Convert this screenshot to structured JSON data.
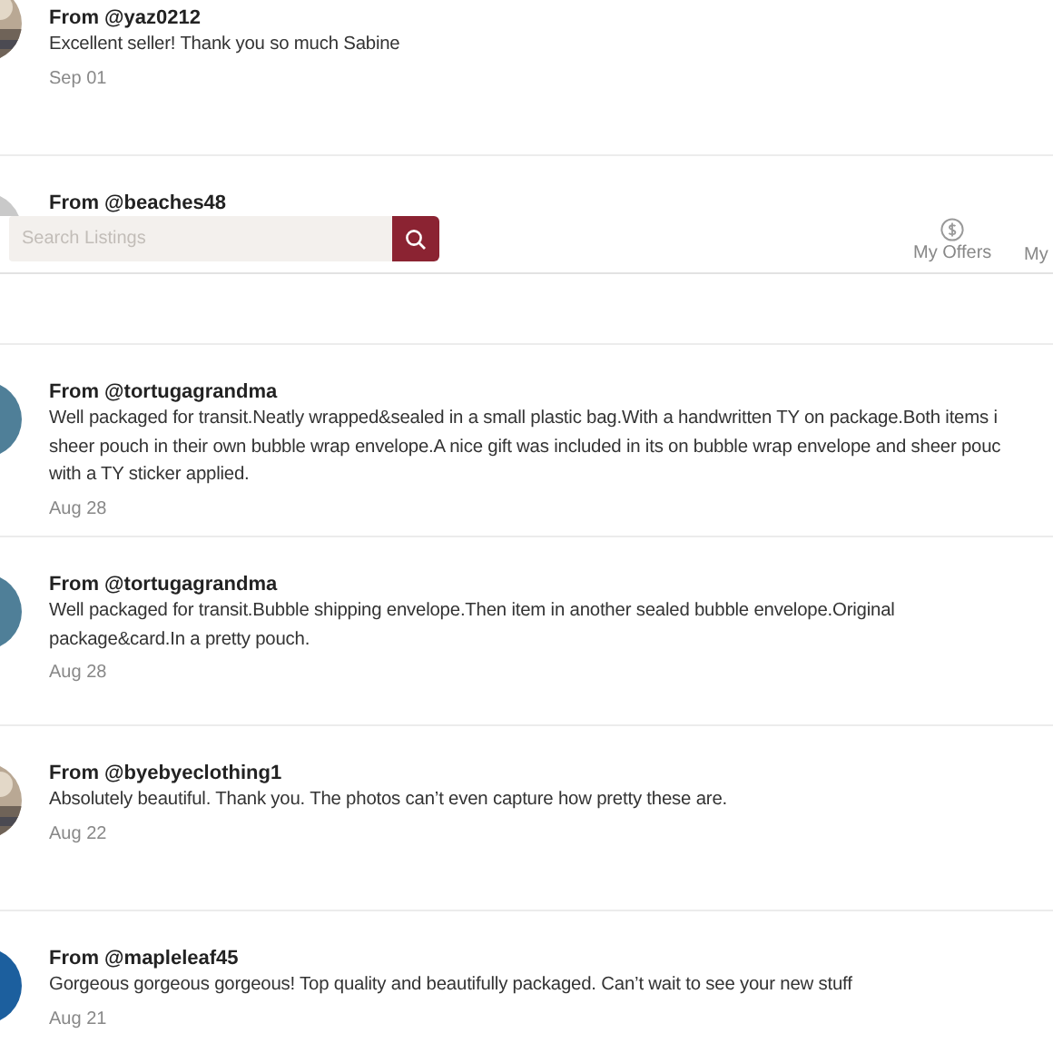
{
  "reviews": [
    {
      "from": "From @yaz0212",
      "lines": [
        "Excellent seller! Thank you so much Sabine"
      ],
      "date": "Sep 01",
      "avatar": {
        "kind": "picture"
      }
    },
    {
      "from": "From @beaches48",
      "avatar": {
        "kind": "plain",
        "color": "#c9c9c9"
      }
    },
    {
      "from": "From @tortugagrandma",
      "lines": [
        "Well packaged for transit.Neatly wrapped&sealed in a small plastic bag.With a handwritten TY on package.Both items i",
        "sheer pouch in their own bubble wrap envelope.A nice gift was included in its on bubble wrap envelope and sheer pouc",
        "with a TY sticker applied."
      ],
      "date": "Aug 28",
      "avatar": {
        "kind": "plain",
        "color": "#4f7f98"
      }
    },
    {
      "from": "From @tortugagrandma",
      "lines": [
        "Well packaged for transit.Bubble shipping envelope.Then item in another sealed bubble envelope.Original",
        "package&card.In a pretty pouch."
      ],
      "date": "Aug 28",
      "avatar": {
        "kind": "plain",
        "color": "#4f7f98"
      }
    },
    {
      "from": "From @byebyeclothing1",
      "lines": [
        "Absolutely beautiful. Thank you. The photos can’t even capture how pretty these are."
      ],
      "date": "Aug 22",
      "avatar": {
        "kind": "picture"
      }
    },
    {
      "from": "From @mapleleaf45",
      "lines": [
        "Gorgeous gorgeous gorgeous! Top quality and beautifully packaged. Can’t wait to see your new stuff"
      ],
      "date": "Aug 21",
      "avatar": {
        "kind": "plain",
        "color": "#1c5f9e"
      }
    }
  ],
  "header": {
    "search": {
      "placeholder": "Search Listings"
    },
    "nav": [
      {
        "label": "My Offers",
        "kind": "offers"
      },
      {
        "label": "My",
        "kind": "cut"
      }
    ]
  }
}
